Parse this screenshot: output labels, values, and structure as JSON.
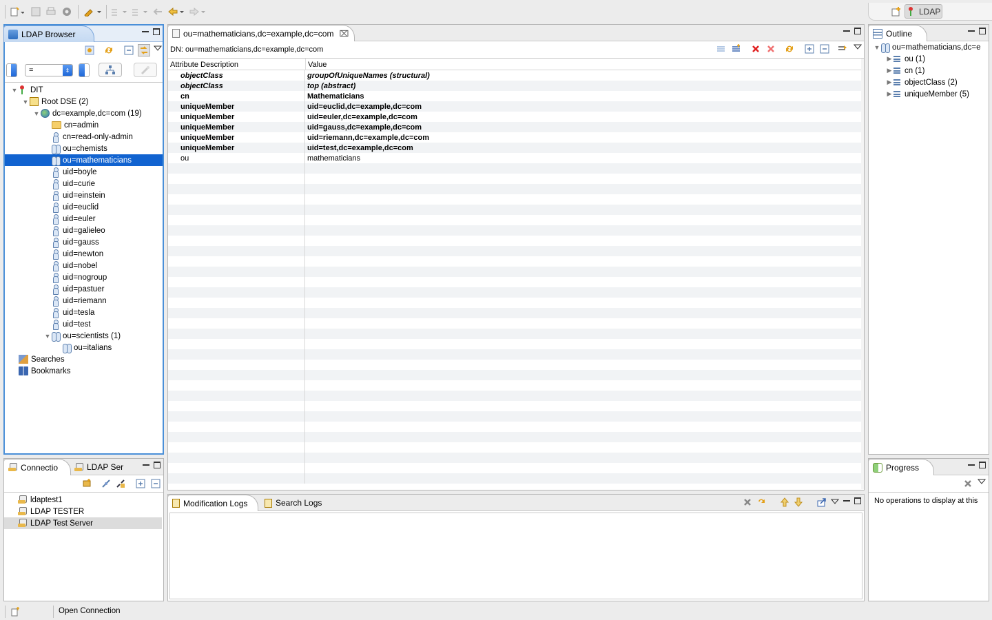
{
  "toolbar": {
    "perspective_label": "LDAP"
  },
  "ldap_browser": {
    "tab_title": "LDAP Browser",
    "filter_operator": "=",
    "tree": [
      {
        "label": "DIT",
        "icon": "dit-icon",
        "level": 0,
        "expanded": true
      },
      {
        "label": "Root DSE (2)",
        "icon": "root-dse-icon",
        "level": 1,
        "expanded": true
      },
      {
        "label": "dc=example,dc=com (19)",
        "icon": "globe-icon",
        "level": 2,
        "expanded": true
      },
      {
        "label": "cn=admin",
        "icon": "folder-icon",
        "level": 3
      },
      {
        "label": "cn=read-only-admin",
        "icon": "person-icon",
        "level": 3
      },
      {
        "label": "ou=chemists",
        "icon": "group-icon",
        "level": 3
      },
      {
        "label": "ou=mathematicians",
        "icon": "group-icon",
        "level": 3,
        "selected": true
      },
      {
        "label": "uid=boyle",
        "icon": "person-icon",
        "level": 3
      },
      {
        "label": "uid=curie",
        "icon": "person-icon",
        "level": 3
      },
      {
        "label": "uid=einstein",
        "icon": "person-icon",
        "level": 3
      },
      {
        "label": "uid=euclid",
        "icon": "person-icon",
        "level": 3
      },
      {
        "label": "uid=euler",
        "icon": "person-icon",
        "level": 3
      },
      {
        "label": "uid=galieleo",
        "icon": "person-icon",
        "level": 3
      },
      {
        "label": "uid=gauss",
        "icon": "person-icon",
        "level": 3
      },
      {
        "label": "uid=newton",
        "icon": "person-icon",
        "level": 3
      },
      {
        "label": "uid=nobel",
        "icon": "person-icon",
        "level": 3
      },
      {
        "label": "uid=nogroup",
        "icon": "person-icon",
        "level": 3
      },
      {
        "label": "uid=pastuer",
        "icon": "person-icon",
        "level": 3
      },
      {
        "label": "uid=riemann",
        "icon": "person-icon",
        "level": 3
      },
      {
        "label": "uid=tesla",
        "icon": "person-icon",
        "level": 3
      },
      {
        "label": "uid=test",
        "icon": "person-icon",
        "level": 3
      },
      {
        "label": "ou=scientists (1)",
        "icon": "group-icon",
        "level": 3,
        "expanded": true
      },
      {
        "label": "ou=italians",
        "icon": "group-icon",
        "level": 4
      },
      {
        "label": "Searches",
        "icon": "search-icon",
        "level": 0
      },
      {
        "label": "Bookmarks",
        "icon": "bookmark-icon",
        "level": 0
      }
    ]
  },
  "connections": {
    "tabs": [
      "Connectio",
      "LDAP Ser"
    ],
    "items": [
      "ldaptest1",
      "LDAP TESTER",
      "LDAP Test Server"
    ],
    "selected_index": 2
  },
  "editor": {
    "tab_title": "ou=mathematicians,dc=example,dc=com",
    "dn": "DN: ou=mathematicians,dc=example,dc=com",
    "columns": [
      "Attribute Description",
      "Value"
    ],
    "rows": [
      {
        "attr": "objectClass",
        "value": "groupOfUniqueNames (structural)",
        "style": "bold-italic"
      },
      {
        "attr": "objectClass",
        "value": "top (abstract)",
        "style": "bold-italic"
      },
      {
        "attr": "cn",
        "value": "Mathematicians",
        "style": "bold"
      },
      {
        "attr": "uniqueMember",
        "value": "uid=euclid,dc=example,dc=com",
        "style": "bold"
      },
      {
        "attr": "uniqueMember",
        "value": "uid=euler,dc=example,dc=com",
        "style": "bold"
      },
      {
        "attr": "uniqueMember",
        "value": "uid=gauss,dc=example,dc=com",
        "style": "bold"
      },
      {
        "attr": "uniqueMember",
        "value": "uid=riemann,dc=example,dc=com",
        "style": "bold"
      },
      {
        "attr": "uniqueMember",
        "value": "uid=test,dc=example,dc=com",
        "style": "bold"
      },
      {
        "attr": "ou",
        "value": "mathematicians",
        "style": "normal"
      }
    ]
  },
  "outline": {
    "tab_title": "Outline",
    "root": "ou=mathematicians,dc=e",
    "items": [
      "ou (1)",
      "cn (1)",
      "objectClass (2)",
      "uniqueMember (5)"
    ]
  },
  "logs": {
    "tabs": [
      "Modification Logs",
      "Search Logs"
    ]
  },
  "progress": {
    "tab_title": "Progress",
    "message": "No operations to display at this"
  },
  "status_bar": {
    "text": "Open Connection"
  },
  "colors": {
    "selection": "#1163d0",
    "active_border": "#4a8fd8",
    "background": "#ececec"
  }
}
